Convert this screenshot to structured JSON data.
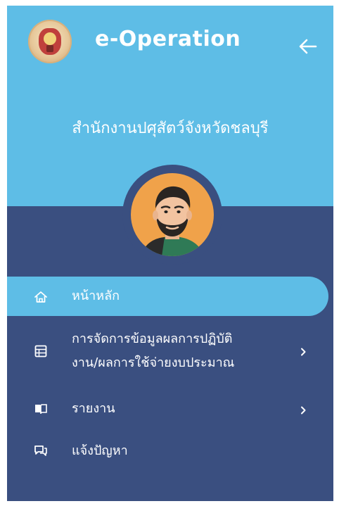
{
  "header": {
    "app_title": "e-Operation",
    "office_name": "สำนักงานปศุสัตว์จังหวัดชลบุรี",
    "logo_icon": "provincial-seal-icon",
    "back_icon": "arrow-left-icon"
  },
  "user": {
    "avatar_icon": "user-avatar"
  },
  "menu": {
    "items": [
      {
        "label": "หน้าหลัก",
        "icon": "home-icon",
        "active": true
      },
      {
        "label_line1": "การจัดการข้อมูลผลการปฏิบัติ",
        "label_line2": "งาน/ผลการใช้จ่ายงบประมาณ",
        "icon": "table-icon",
        "has_submenu": true
      },
      {
        "label": "รายงาน",
        "icon": "book-icon",
        "has_submenu": true
      },
      {
        "label": "แจ้งปัญหา",
        "icon": "chat-icon"
      }
    ]
  },
  "colors": {
    "header_bg": "#5ebde6",
    "sidebar_bg": "#3a4f80",
    "active_bg": "#5ebde6",
    "text": "#ffffff",
    "avatar_bg": "#f0a24a"
  }
}
